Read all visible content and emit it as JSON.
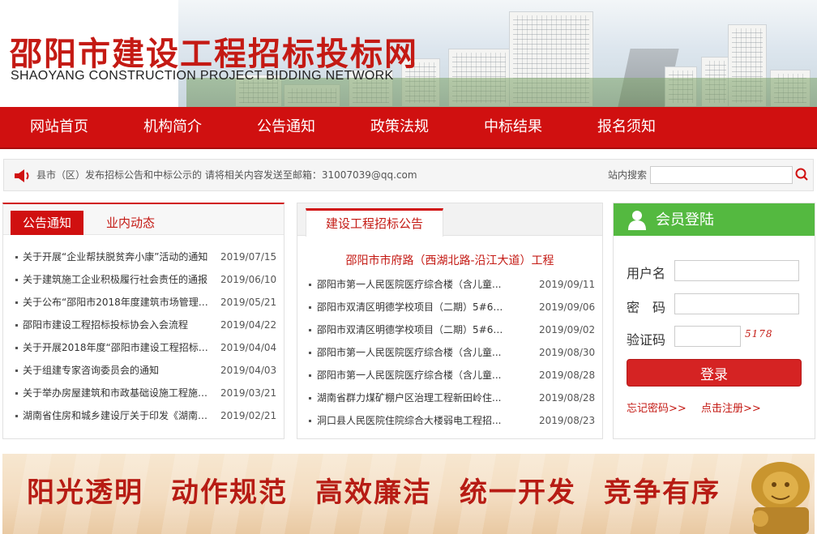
{
  "header": {
    "title_cn": "邵阳市建设工程招标投标网",
    "title_en": "SHAOYANG CONSTRUCTION PROJECT BIDDING NETWORK"
  },
  "nav": {
    "items": [
      "网站首页",
      "机构简介",
      "公告通知",
      "政策法规",
      "中标结果",
      "报名须知"
    ]
  },
  "notice": {
    "text": "县市（区）发布招标公告和中标公示的 请将相关内容发送至邮箱：31007039@qq.com",
    "search_label": "站内搜索",
    "search_value": ""
  },
  "left_panel": {
    "tab_active": "公告通知",
    "tab_inactive": "业内动态",
    "items": [
      {
        "title": "关于开展“企业帮扶脱贫奔小康”活动的通知",
        "date": "2019/07/15"
      },
      {
        "title": "关于建筑施工企业积极履行社会责任的通报",
        "date": "2019/06/10"
      },
      {
        "title": "关于公布“邵阳市2018年度建筑市场管理先…",
        "date": "2019/05/21"
      },
      {
        "title": "邵阳市建设工程招标投标协会入会流程",
        "date": "2019/04/22"
      },
      {
        "title": "关于开展2018年度“邵阳市建设工程招标投标履…",
        "date": "2019/04/04"
      },
      {
        "title": "关于组建专家咨询委员会的通知",
        "date": "2019/04/03"
      },
      {
        "title": "关于举办房屋建筑和市政基础设施工程施工…",
        "date": "2019/03/21"
      },
      {
        "title": "湖南省住房和城乡建设厅关于印发《湖南省…",
        "date": "2019/02/21"
      }
    ]
  },
  "mid_panel": {
    "tab": "建设工程招标公告",
    "headline": "邵阳市市府路（西湖北路-沿江大道）工程",
    "items": [
      {
        "title": "邵阳市第一人民医院医疗综合楼（含儿童...",
        "date": "2019/09/11"
      },
      {
        "title": "邵阳市双清区明德学校项目（二期）5#6#...",
        "date": "2019/09/06"
      },
      {
        "title": "邵阳市双清区明德学校项目（二期）5#6#...",
        "date": "2019/09/02"
      },
      {
        "title": "邵阳市第一人民医院医疗综合楼（含儿童...",
        "date": "2019/08/30"
      },
      {
        "title": "邵阳市第一人民医院医疗综合楼（含儿童...",
        "date": "2019/08/28"
      },
      {
        "title": "湖南省群力煤矿棚户区治理工程新田岭住...",
        "date": "2019/08/28"
      },
      {
        "title": "洞口县人民医院住院综合大楼弱电工程招...",
        "date": "2019/08/23"
      }
    ]
  },
  "login": {
    "title": "会员登陆",
    "username_label": "用户名",
    "password_label": "密　码",
    "captcha_label": "验证码",
    "captcha_code": "5178",
    "submit": "登录",
    "forgot": "忘记密码>>",
    "register": "点击注册>>"
  },
  "slogan": {
    "words": [
      "阳光透明",
      "动作规范",
      "高效廉洁",
      "统一开发",
      "竞争有序"
    ]
  },
  "colors": {
    "brand_red": "#d01010",
    "login_green": "#54b940",
    "link_red": "#c41a14"
  },
  "icons": {
    "notice": "speaker-icon",
    "search": "search-icon",
    "user": "user-icon",
    "mascot": "lion-statue-icon"
  }
}
